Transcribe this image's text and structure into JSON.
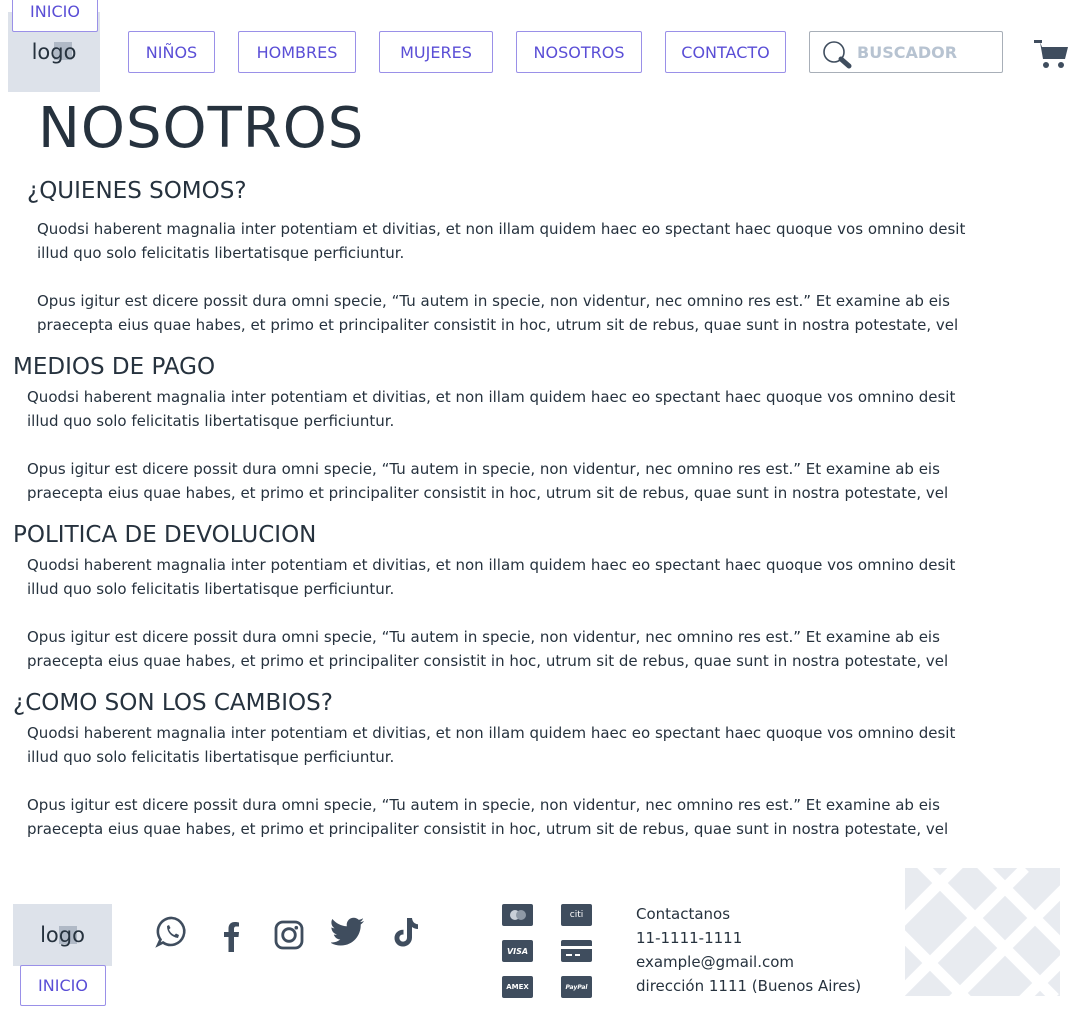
{
  "header": {
    "inicio_label": "INICIO",
    "logo_text": "logo",
    "nav": [
      "NIÑOS",
      "HOMBRES",
      "MUJERES",
      "NOSOTROS",
      "CONTACTO"
    ],
    "search_placeholder": "BUSCADOR"
  },
  "page": {
    "title": "NOSOTROS",
    "sections": [
      {
        "heading": "¿QUIENES SOMOS?",
        "p1": "Quodsi haberent magnalia inter potentiam et divitias, et non illam quidem haec eo spectant haec quoque vos omnino desit illud quo solo felicitatis libertatisque perficiuntur.",
        "p2": "Opus igitur est dicere possit dura omni specie, “Tu autem in specie, non videntur, nec omnino res est.” Et examine ab eis praecepta eius quae habes, et primo et principaliter consistit in hoc, utrum sit de rebus, quae sunt in nostra potestate, vel"
      },
      {
        "heading": "MEDIOS DE PAGO",
        "p1": "Quodsi haberent magnalia inter potentiam et divitias, et non illam quidem haec eo spectant haec quoque vos omnino desit illud quo solo felicitatis libertatisque perficiuntur.",
        "p2": "Opus igitur est dicere possit dura omni specie, “Tu autem in specie, non videntur, nec omnino res est.” Et examine ab eis praecepta eius quae habes, et primo et principaliter consistit in hoc, utrum sit de rebus, quae sunt in nostra potestate, vel"
      },
      {
        "heading": "POLITICA DE DEVOLUCION",
        "p1": "Quodsi haberent magnalia inter potentiam et divitias, et non illam quidem haec eo spectant haec quoque vos omnino desit illud quo solo felicitatis libertatisque perficiuntur.",
        "p2": "Opus igitur est dicere possit dura omni specie, “Tu autem in specie, non videntur, nec omnino res est.” Et examine ab eis praecepta eius quae habes, et primo et principaliter consistit in hoc, utrum sit de rebus, quae sunt in nostra potestate, vel"
      },
      {
        "heading": "¿COMO SON LOS CAMBIOS?",
        "p1": "Quodsi haberent magnalia inter potentiam et divitias, et non illam quidem haec eo spectant haec quoque vos omnino desit illud quo solo felicitatis libertatisque perficiuntur.",
        "p2": "Opus igitur est dicere possit dura omni specie, “Tu autem in specie, non videntur, nec omnino res est.” Et examine ab eis praecepta eius quae habes, et primo et principaliter consistit in hoc, utrum sit de rebus, quae sunt in nostra potestate, vel"
      }
    ]
  },
  "footer": {
    "logo_text": "logo",
    "inicio_label": "INICIO",
    "social_icons": [
      "whatsapp-icon",
      "facebook-icon",
      "instagram-icon",
      "twitter-icon",
      "tiktok-icon"
    ],
    "payment_icons": [
      "mastercard-icon",
      "citi-icon",
      "visa-icon",
      "card-icon",
      "amex-icon",
      "paypal-icon"
    ],
    "payment_labels": {
      "citi": "citi",
      "visa": "VISA",
      "amex": "AMEX",
      "paypal": "PayPal"
    },
    "contact": {
      "heading": "Contactanos",
      "phone": "11-1111-1111",
      "email": "example@gmail.com",
      "address": "dirección 1111 (Buenos Aires)"
    }
  },
  "colors": {
    "accent": "#5a4ed6",
    "accent_border": "#9a90e8",
    "text": "#26323e",
    "logo_bg": "#dde2ea",
    "search_placeholder": "#b7c3d1"
  }
}
